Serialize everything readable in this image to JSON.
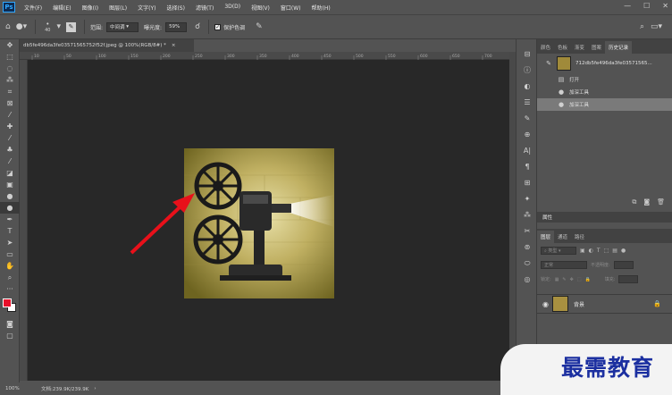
{
  "app": {
    "logo": "Ps"
  },
  "menu": {
    "items": [
      "文件(F)",
      "编辑(E)",
      "图像(I)",
      "图层(L)",
      "文字(Y)",
      "选择(S)",
      "滤镜(T)",
      "3D(D)",
      "视图(V)",
      "窗口(W)",
      "帮助(H)"
    ]
  },
  "window_controls": {
    "minimize": "—",
    "maximize": "☐",
    "close": "✕"
  },
  "options": {
    "brush_size": "40",
    "range_label": "范围:",
    "range_value": "中间调",
    "exposure_label": "曝光度:",
    "exposure_value": "59%",
    "protect_tones_label": "保护色调",
    "protect_tones_checked": true
  },
  "document": {
    "tab_title": "db5fe496da3fe03571565752f52f.jpeg @ 100%(RGB/8#) *",
    "ruler_ticks": [
      "10",
      "50",
      "100",
      "150",
      "200",
      "250",
      "300",
      "350",
      "400",
      "450",
      "500",
      "550",
      "600",
      "650",
      "700"
    ],
    "status_zoom": "100%",
    "status_doc": "文档:239.9K/239.9K"
  },
  "panels": {
    "top_tabs": [
      "颜色",
      "色板",
      "渐变",
      "图案",
      "历史记录"
    ],
    "active_top_tab": "历史记录",
    "history": {
      "snapshot_name": "712db5fe496da3fe03571565...",
      "items": [
        {
          "label": "打开",
          "active": false
        },
        {
          "label": "加深工具",
          "active": false
        },
        {
          "label": "加深工具",
          "active": true
        }
      ]
    },
    "attributes_title": "属性",
    "layer_tabs": [
      "图层",
      "通道",
      "路径"
    ],
    "active_layer_tab": "图层",
    "layer_kind_placeholder": "类型",
    "blend_mode": "正常",
    "opacity_label": "不透明度:",
    "lock_label": "锁定:",
    "fill_label": "填充:",
    "layers": [
      {
        "name": "背景",
        "locked": true
      }
    ]
  },
  "watermark": {
    "text": "最需教育"
  },
  "colors": {
    "foreground": "#e8102a",
    "background": "#ffffff",
    "arrow": "#e8101a"
  }
}
